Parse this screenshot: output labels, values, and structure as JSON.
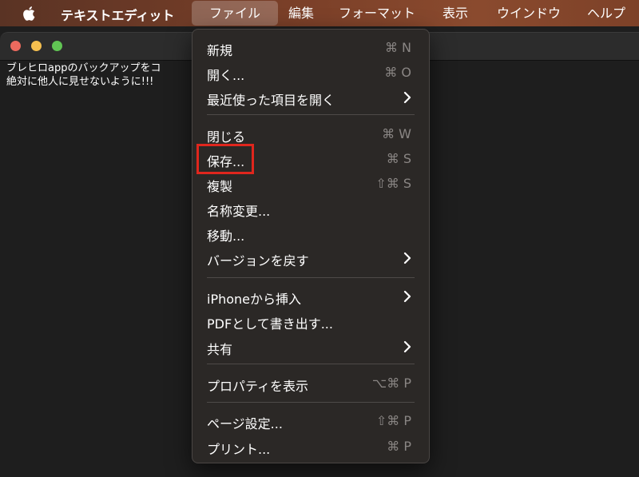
{
  "menubar": {
    "app_name": "テキストエディット",
    "menus": [
      {
        "label": "ファイル",
        "active": true
      },
      {
        "label": "編集"
      },
      {
        "label": "フォーマット"
      },
      {
        "label": "表示"
      },
      {
        "label": "ウインドウ"
      },
      {
        "label": "ヘルプ"
      }
    ]
  },
  "document": {
    "line1": "ブレヒロappのバックアップをコ",
    "line2": "絶対に他人に見せないように!!!"
  },
  "file_menu": {
    "items": [
      {
        "label": "新規",
        "shortcut": "⌘ N"
      },
      {
        "label": "開く...",
        "shortcut": "⌘ O"
      },
      {
        "label": "最近使った項目を開く",
        "submenu": true
      },
      {
        "label": "閉じる",
        "shortcut": "⌘ W"
      },
      {
        "label": "保存...",
        "shortcut": "⌘ S",
        "highlighted": true
      },
      {
        "label": "複製",
        "shortcut": "⇧⌘ S"
      },
      {
        "label": "名称変更..."
      },
      {
        "label": "移動..."
      },
      {
        "label": "バージョンを戻す",
        "submenu": true
      },
      {
        "label": "iPhoneから挿入",
        "submenu": true
      },
      {
        "label": "PDFとして書き出す..."
      },
      {
        "label": "共有",
        "submenu": true
      },
      {
        "label": "プロパティを表示",
        "shortcut": "⌥⌘ P"
      },
      {
        "label": "ページ設定...",
        "shortcut": "⇧⌘ P"
      },
      {
        "label": "プリント...",
        "shortcut": "⌘ P"
      }
    ]
  },
  "colors": {
    "highlight": "#e0261d",
    "menu_bg": "#2b2826",
    "shortcut_text": "#8a8684"
  }
}
